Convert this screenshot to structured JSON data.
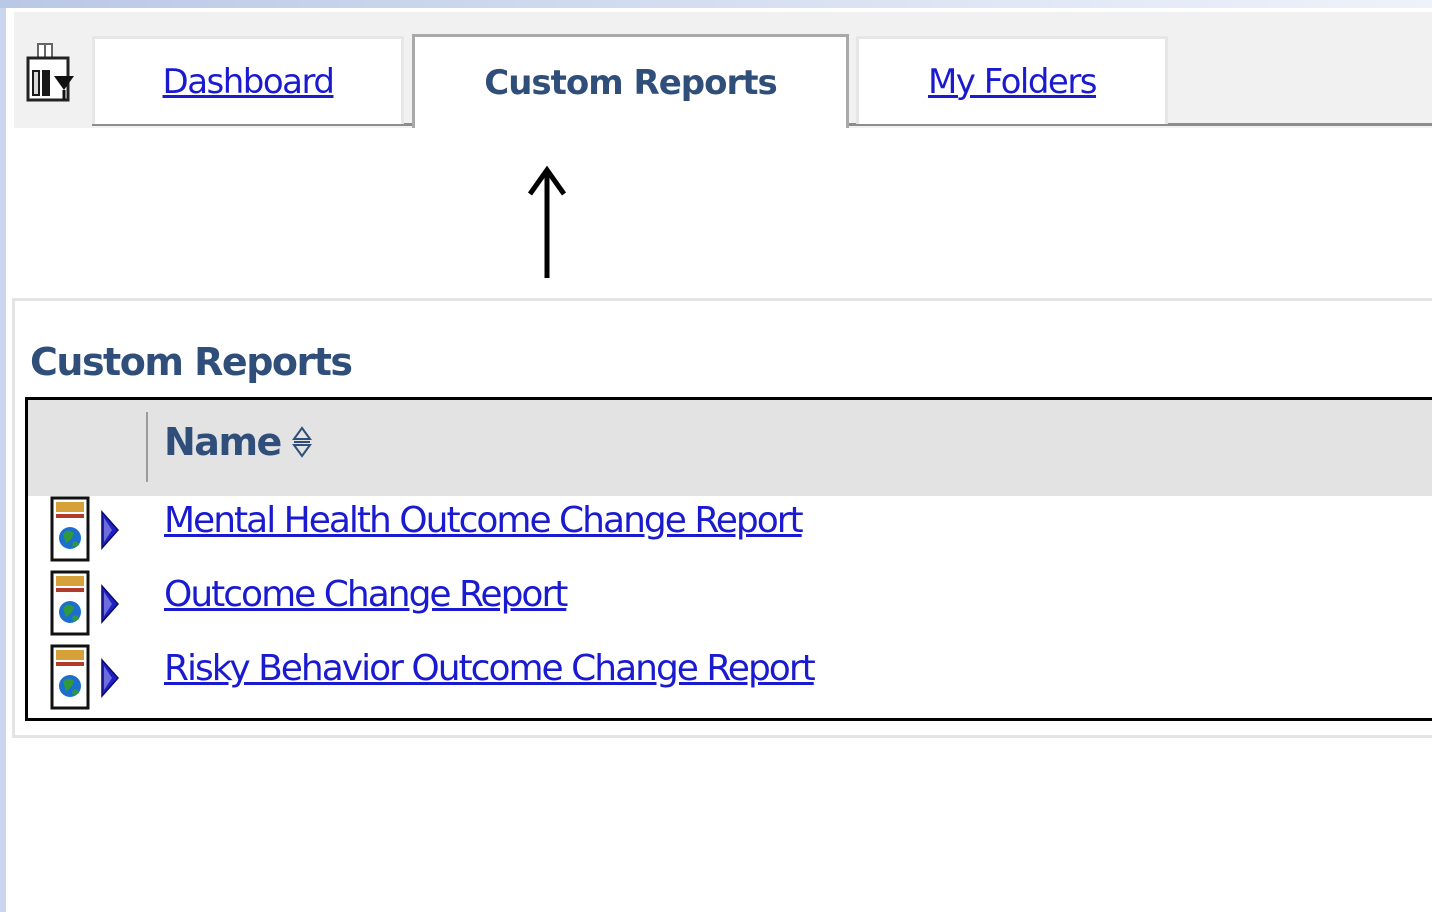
{
  "tabs": {
    "home_icon": "home-menu-icon",
    "items": [
      {
        "label": "Dashboard",
        "active": false
      },
      {
        "label": "Custom Reports",
        "active": true
      },
      {
        "label": "My Folders",
        "active": false
      }
    ]
  },
  "annotation": {
    "icon": "up-arrow-icon"
  },
  "panel": {
    "title": "Custom Reports",
    "grid": {
      "columns": [
        {
          "label": "Name",
          "sort_icon": "sort-icon"
        }
      ],
      "rows": [
        {
          "name": "Mental Health Outcome Change Report",
          "icon": "report-icon",
          "expand_icon": "expand-arrow-icon"
        },
        {
          "name": "Outcome Change Report",
          "icon": "report-icon",
          "expand_icon": "expand-arrow-icon"
        },
        {
          "name": "Risky Behavior Outcome Change Report",
          "icon": "report-icon",
          "expand_icon": "expand-arrow-icon"
        }
      ]
    }
  },
  "colors": {
    "link": "#1a1ad0",
    "heading": "#2f4f7a",
    "header_bg": "#e3e3e3",
    "expand_arrow": "#2020c8"
  }
}
